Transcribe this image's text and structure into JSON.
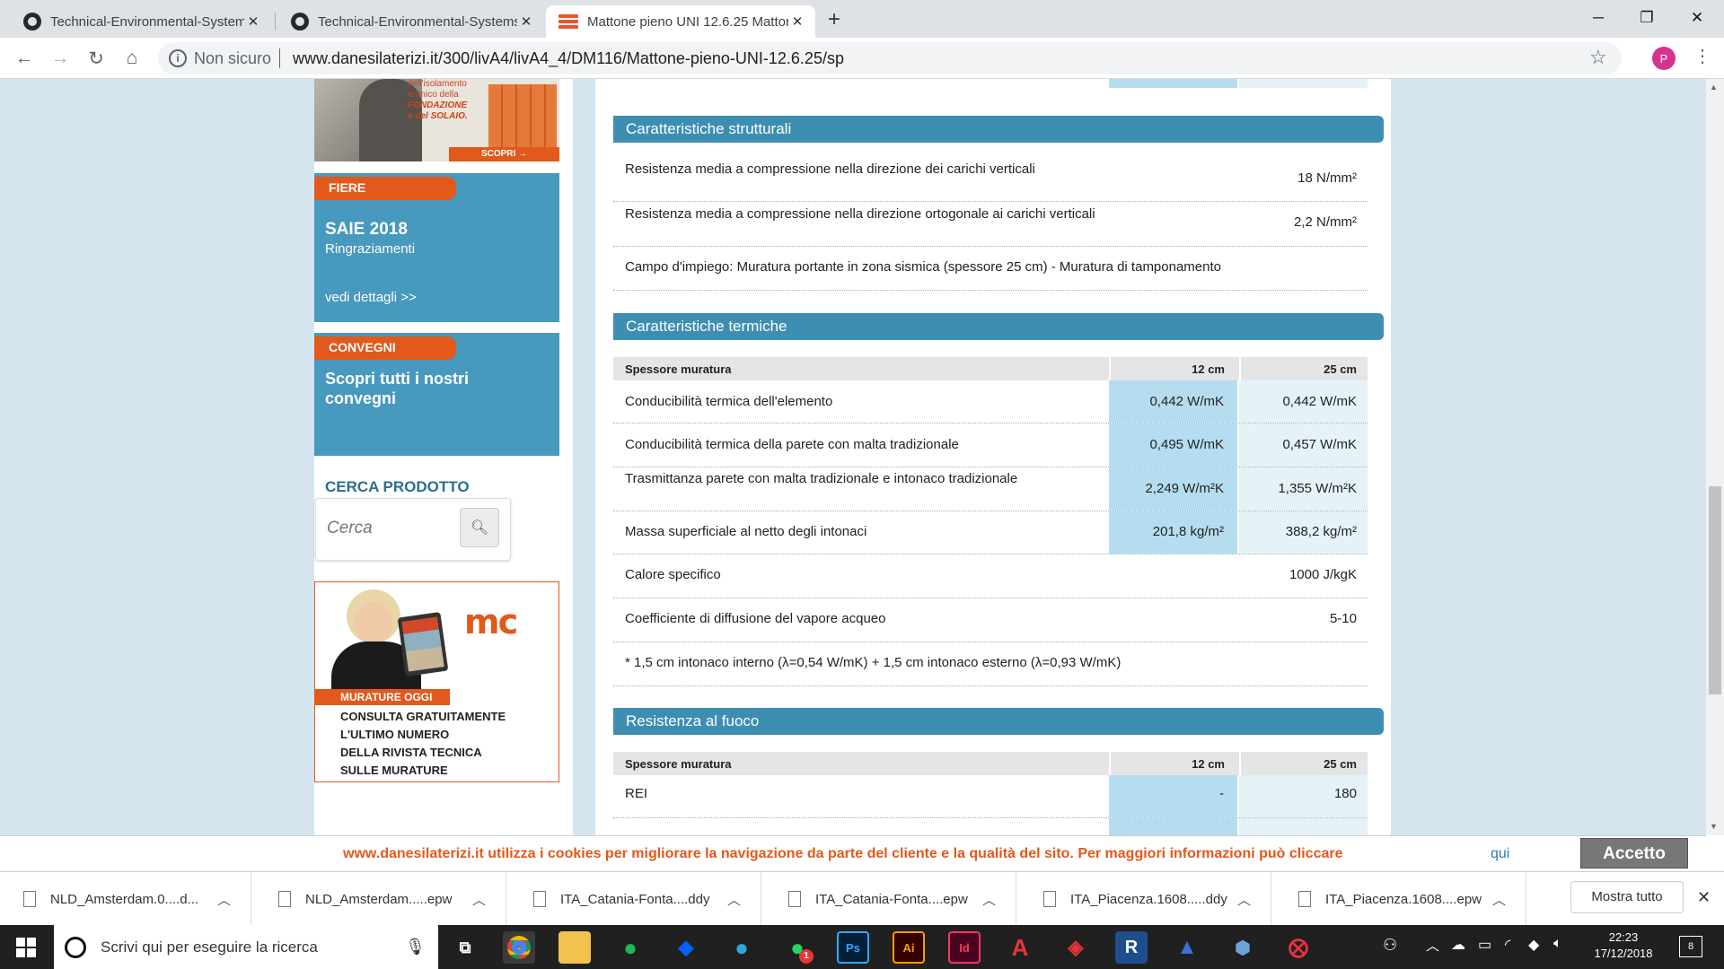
{
  "browser": {
    "tabs": [
      {
        "title": "Technical-Environmental-Systems"
      },
      {
        "title": "Technical-Environmental-Systems"
      },
      {
        "title": "Mattone pieno UNI 12.6.25 Mattone"
      }
    ],
    "security_label": "Non sicuro",
    "url": "www.danesilaterizi.it/300/livA4/livA4_4/DM116/Mattone-pieno-UNI-12.6.25/sp",
    "profile_initial": "P"
  },
  "sidebar": {
    "banner_top": {
      "lines": [
        "dell'isolamento",
        "termico della",
        "FONDAZIONE",
        "e del SOLAIO."
      ],
      "cta": "SCOPRI →"
    },
    "fiere": {
      "tag": "FIERE",
      "title": "SAIE 2018",
      "subtitle": "Ringraziamenti",
      "link": "vedi dettagli >>"
    },
    "convegni": {
      "tag": "CONVEGNI",
      "title": "Scopri tutti i nostri convegni"
    },
    "search": {
      "heading": "CERCA PRODOTTO",
      "placeholder": "Cerca"
    },
    "magazine": {
      "logo": "mc",
      "tag": "MURATURE OGGI",
      "lines": [
        "CONSULTA GRATUITAMENTE",
        "L'ULTIMO NUMERO",
        "DELLA RIVISTA TECNICA",
        "SULLE MURATURE"
      ]
    }
  },
  "structural": {
    "title": "Caratteristiche strutturali",
    "rows": [
      {
        "label": "Resistenza media a compressione nella direzione dei carichi verticali",
        "value": "18 N/mm²"
      },
      {
        "label": "Resistenza media a compressione nella direzione ortogonale ai carichi verticali",
        "value": "2,2 N/mm²"
      }
    ],
    "usage": "Campo d'impiego: Muratura portante in zona sismica (spessore 25 cm) - Muratura di tamponamento"
  },
  "thermal": {
    "title": "Caratteristiche termiche",
    "header": {
      "label": "Spessore muratura",
      "c12": "12 cm",
      "c25": "25 cm"
    },
    "rows": [
      {
        "label": "Conducibilità termica dell'elemento",
        "v12": "0,442 W/mK",
        "v25": "0,442 W/mK"
      },
      {
        "label": "Conducibilità termica della parete con malta tradizionale",
        "v12": "0,495 W/mK",
        "v25": "0,457 W/mK"
      },
      {
        "label": "Trasmittanza parete con malta tradizionale e intonaco tradizionale",
        "v12": "2,249 W/m²K",
        "v25": "1,355 W/m²K"
      },
      {
        "label": "Massa superficiale al netto degli intonaci",
        "v12": "201,8 kg/m²",
        "v25": "388,2 kg/m²"
      }
    ],
    "specific_heat": {
      "label": "Calore specifico",
      "value": "1000 J/kgK"
    },
    "vapor": {
      "label": "Coefficiente di diffusione del vapore acqueo",
      "value": "5-10"
    },
    "note": "* 1,5 cm intonaco interno (λ=0,54 W/mK) + 1,5 cm intonaco esterno (λ=0,93 W/mK)"
  },
  "fire": {
    "title": "Resistenza al fuoco",
    "header": {
      "label": "Spessore muratura",
      "c12": "12 cm",
      "c25": "25 cm"
    },
    "rows": [
      {
        "label": "REI",
        "v12": "-",
        "v25": "180"
      }
    ]
  },
  "cookie": {
    "text": "www.danesilaterizi.it utilizza i cookies per migliorare la navigazione da parte del cliente e la qualità del sito. Per maggiori informazioni può cliccare",
    "link": "qui",
    "accept": "Accetto"
  },
  "downloads": {
    "items": [
      {
        "name": "NLD_Amsterdam.0....d..."
      },
      {
        "name": "NLD_Amsterdam.....epw"
      },
      {
        "name": "ITA_Catania-Fonta....ddy"
      },
      {
        "name": "ITA_Catania-Fonta....epw"
      },
      {
        "name": "ITA_Piacenza.1608.....ddy"
      },
      {
        "name": "ITA_Piacenza.1608....epw"
      }
    ],
    "show_all": "Mostra tutto"
  },
  "taskbar": {
    "search_placeholder": "Scrivi qui per eseguire la ricerca",
    "time": "22:23",
    "date": "17/12/2018",
    "notifications": "8",
    "whatsapp_badge": "1"
  },
  "colors": {
    "section_header": "#3e8eb2",
    "sidebar_panel": "#4799be",
    "accent_orange": "#e2591b",
    "cookie_text": "#e2591b"
  }
}
